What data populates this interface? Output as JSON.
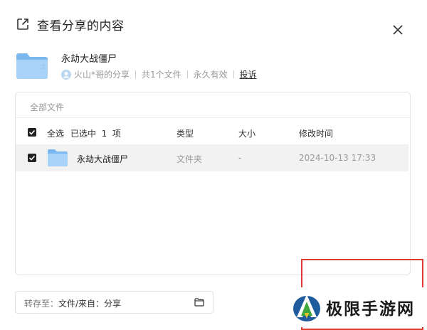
{
  "header": {
    "title": "查看分享的内容",
    "share_icon": "external-link-icon",
    "close_icon": "close-icon"
  },
  "share": {
    "name": "永劫大战僵尸",
    "owner": "火山*哥的分享",
    "file_count": "共1个文件",
    "validity": "永久有效",
    "report_label": "投诉"
  },
  "file_panel": {
    "breadcrumb": "全部文件",
    "select_all_label": "全选",
    "selected_label": "已选中  1  项",
    "columns": {
      "type": "类型",
      "size": "大小",
      "modified": "修改时间"
    },
    "rows": [
      {
        "name": "永劫大战僵尸",
        "type": "文件夹",
        "size": "-",
        "modified": "2024-10-13 17:33",
        "checked": true
      }
    ]
  },
  "save_to": {
    "label": "转存至：",
    "path": "文件/来自：分享",
    "icon": "folder-outline-icon"
  },
  "watermark": {
    "text": "极限手游网"
  },
  "colors": {
    "folder_blue": "#7cb8f0",
    "highlight_red": "#e23a2e",
    "row_bg": "#f2f2f2",
    "muted_text": "#999999"
  }
}
